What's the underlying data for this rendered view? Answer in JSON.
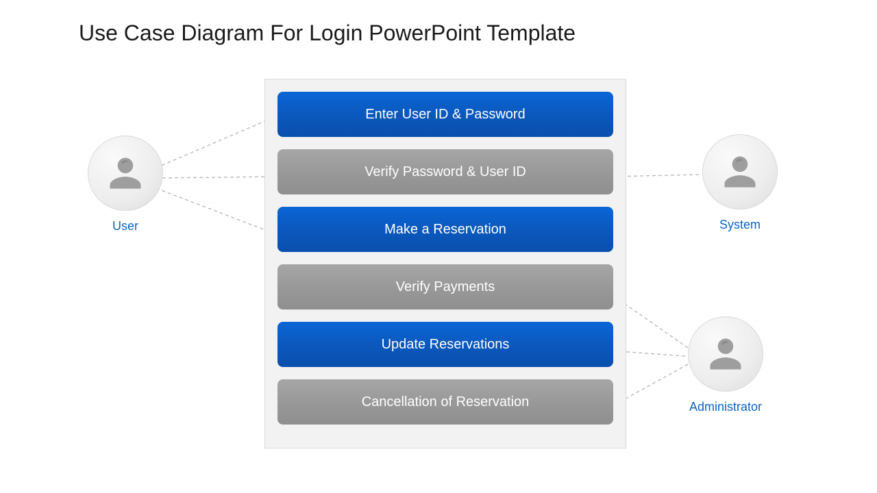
{
  "title": "Use Case Diagram For Login PowerPoint Template",
  "actors": {
    "user": "User",
    "system": "System",
    "admin": "Administrator"
  },
  "use_cases": [
    {
      "label": "Enter User ID & Password",
      "color": "blue"
    },
    {
      "label": "Verify Password & User ID",
      "color": "gray"
    },
    {
      "label": "Make a Reservation",
      "color": "blue"
    },
    {
      "label": "Verify Payments",
      "color": "gray"
    },
    {
      "label": "Update Reservations",
      "color": "blue"
    },
    {
      "label": "Cancellation of Reservation",
      "color": "gray"
    }
  ],
  "colors": {
    "blue": "#0b58bd",
    "gray": "#999999",
    "label": "#0b63c4"
  }
}
